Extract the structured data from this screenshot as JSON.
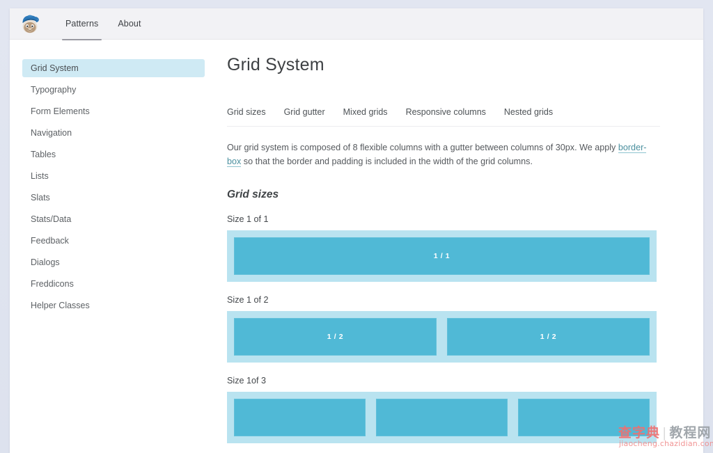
{
  "header": {
    "logo_alt": "mailchimp-freddie-logo",
    "tabs": [
      {
        "label": "Patterns",
        "active": true
      },
      {
        "label": "About",
        "active": false
      }
    ]
  },
  "sidebar": {
    "items": [
      {
        "label": "Grid System",
        "active": true
      },
      {
        "label": "Typography",
        "active": false
      },
      {
        "label": "Form Elements",
        "active": false
      },
      {
        "label": "Navigation",
        "active": false
      },
      {
        "label": "Tables",
        "active": false
      },
      {
        "label": "Lists",
        "active": false
      },
      {
        "label": "Slats",
        "active": false
      },
      {
        "label": "Stats/Data",
        "active": false
      },
      {
        "label": "Feedback",
        "active": false
      },
      {
        "label": "Dialogs",
        "active": false
      },
      {
        "label": "Freddicons",
        "active": false
      },
      {
        "label": "Helper Classes",
        "active": false
      }
    ]
  },
  "main": {
    "title": "Grid System",
    "tabs": [
      {
        "label": "Grid sizes"
      },
      {
        "label": "Grid gutter"
      },
      {
        "label": "Mixed grids"
      },
      {
        "label": "Responsive columns"
      },
      {
        "label": "Nested grids"
      }
    ],
    "intro": {
      "before_link": "Our grid system is composed of 8 flexible columns with a gutter between columns of 30px. We apply ",
      "link_text": "border-box",
      "after_link": " so that the border and padding is included in the width of the grid columns."
    },
    "section_heading": "Grid sizes",
    "demos": [
      {
        "label": "Size 1 of 1",
        "columns": [
          "1 / 1"
        ]
      },
      {
        "label": "Size 1 of 2",
        "columns": [
          "1 / 2",
          "1 / 2"
        ]
      },
      {
        "label": "Size 1of 3",
        "columns": [
          "",
          "",
          ""
        ]
      }
    ]
  },
  "watermark": {
    "text_red": "查字典",
    "separator": "|",
    "text_gray": "教程网",
    "url": "jiaocheng.chazidian.com"
  },
  "colors": {
    "page_background": "#dfe3ef",
    "card": "#ffffff",
    "header_background": "#f2f2f5",
    "sidebar_active": "#cfeaf4",
    "grid_outer": "#b9e3f0",
    "grid_column": "#50b9d6",
    "link": "#4a8f9e"
  }
}
